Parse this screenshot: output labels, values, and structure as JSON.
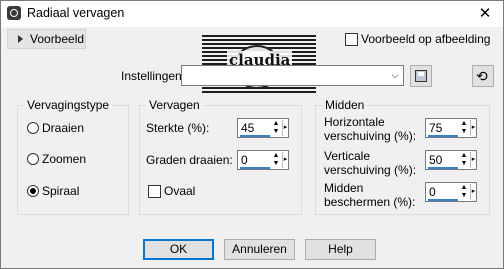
{
  "window": {
    "title": "Radiaal vervagen",
    "close_glyph": "✕",
    "app_icon": "app-icon"
  },
  "preview": {
    "label": "Voorbeeld",
    "on_image_label": "Voorbeeld op afbeelding",
    "on_image_checked": false
  },
  "banner": {
    "text": "claudia"
  },
  "settings": {
    "label": "Instellingen",
    "value": "",
    "dropdown_glyph": "⌵",
    "reset_glyph": "⟲"
  },
  "type_group": {
    "title": "Vervagingstype",
    "options": [
      {
        "label": "Draaien",
        "checked": false
      },
      {
        "label": "Zoomen",
        "checked": false
      },
      {
        "label": "Spiraal",
        "checked": true
      }
    ]
  },
  "blur_group": {
    "title": "Vervagen",
    "strength_label": "Sterkte (%):",
    "strength_value": "45",
    "rotate_label": "Graden draaien:",
    "rotate_value": "0",
    "oval_label": "Ovaal",
    "oval_checked": false
  },
  "center_group": {
    "title": "Midden",
    "h_offset_label_1": "Horizontale",
    "h_offset_label_2": "verschuiving (%):",
    "h_offset_value": "75",
    "v_offset_label_1": "Verticale",
    "v_offset_label_2": "verschuiving (%):",
    "v_offset_value": "50",
    "protect_label_1": "Midden",
    "protect_label_2": "beschermen (%):",
    "protect_value": "0"
  },
  "buttons": {
    "ok": "OK",
    "cancel": "Annuleren",
    "help": "Help"
  },
  "spin_glyphs": {
    "up": "▲",
    "down": "▼",
    "popup": "▸"
  },
  "colors": {
    "accent": "#0078d7",
    "spin_underline": "#3c7fd0"
  }
}
